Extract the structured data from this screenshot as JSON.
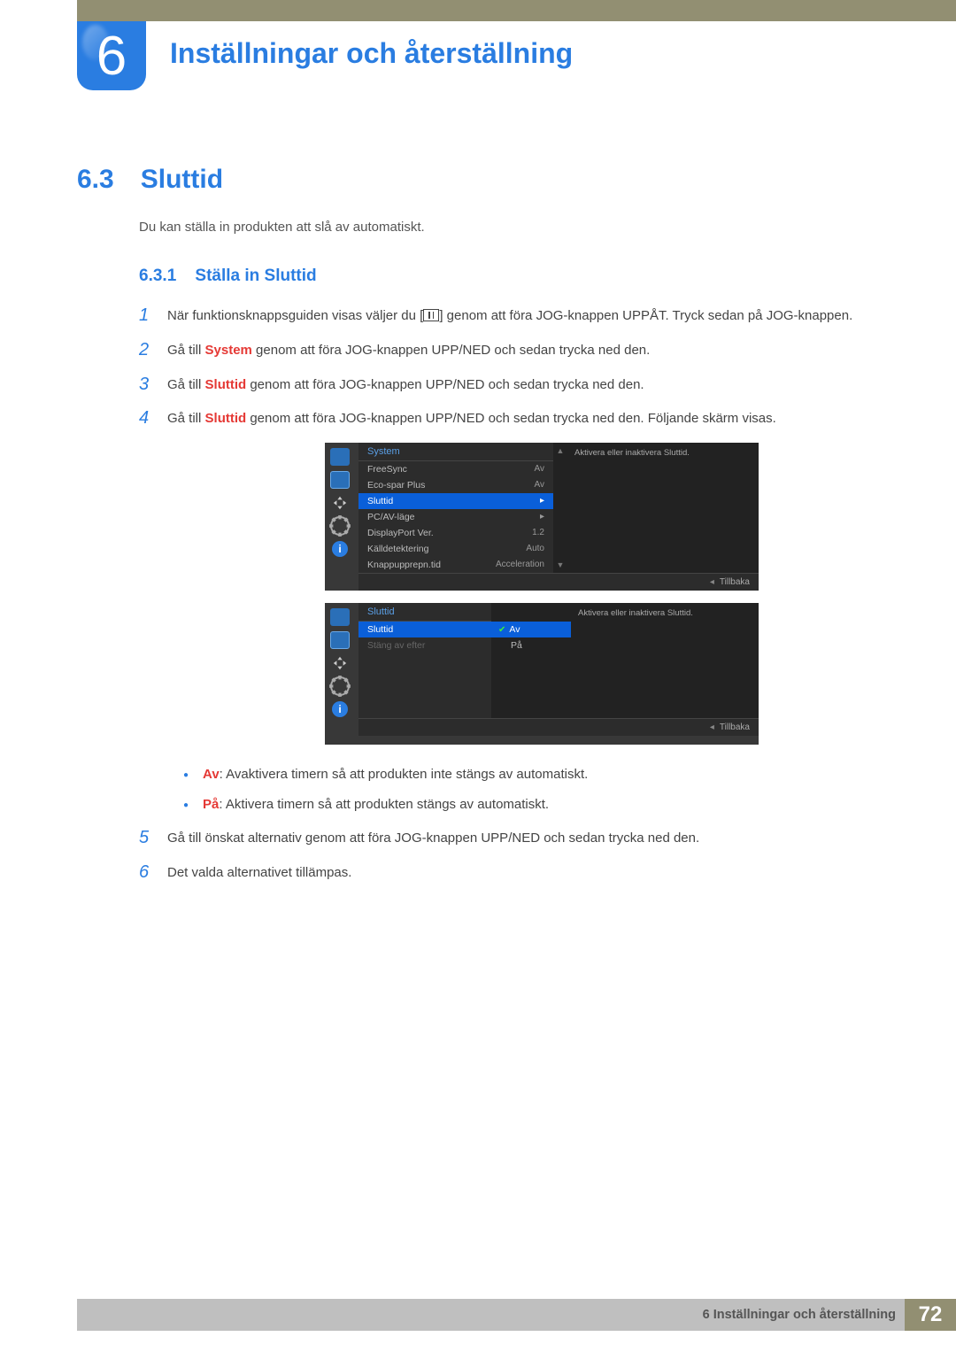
{
  "chapter": {
    "number": "6",
    "title": "Inställningar och återställning"
  },
  "section": {
    "number": "6.3",
    "title": "Sluttid"
  },
  "intro": "Du kan ställa in produkten att slå av automatiskt.",
  "subsection": {
    "number": "6.3.1",
    "title": "Ställa in Sluttid"
  },
  "steps": {
    "s1": {
      "num": "1",
      "pre": "När funktionsknappsguiden visas väljer du [",
      "post": "] genom att föra JOG-knappen UPPÅT. Tryck sedan på JOG-knappen."
    },
    "s2": {
      "num": "2",
      "pre": "Gå till ",
      "hl": "System",
      "post": " genom att föra JOG-knappen UPP/NED och sedan trycka ned den."
    },
    "s3": {
      "num": "3",
      "pre": "Gå till ",
      "hl": "Sluttid",
      "post": " genom att föra JOG-knappen UPP/NED och sedan trycka ned den."
    },
    "s4": {
      "num": "4",
      "pre": "Gå till ",
      "hl": "Sluttid",
      "post": " genom att föra JOG-knappen UPP/NED och sedan trycka ned den. Följande skärm visas."
    },
    "s5": {
      "num": "5",
      "text": "Gå till önskat alternativ genom att föra JOG-knappen UPP/NED och sedan trycka ned den."
    },
    "s6": {
      "num": "6",
      "text": "Det valda alternativet tillämpas."
    }
  },
  "osd1": {
    "header": "System",
    "help": "Aktivera eller inaktivera Sluttid.",
    "rows": [
      {
        "label": "FreeSync",
        "value": "Av"
      },
      {
        "label": "Eco-spar Plus",
        "value": "Av"
      },
      {
        "label": "Sluttid",
        "value": "▸",
        "selected": true
      },
      {
        "label": "PC/AV-läge",
        "value": "▸"
      },
      {
        "label": "DisplayPort Ver.",
        "value": "1.2"
      },
      {
        "label": "Källdetektering",
        "value": "Auto"
      },
      {
        "label": "Knappupprepn.tid",
        "value": "Acceleration"
      }
    ],
    "back": "Tillbaka"
  },
  "osd2": {
    "header": "Sluttid",
    "help": "Aktivera eller inaktivera Sluttid.",
    "rows": [
      {
        "label": "Sluttid",
        "selected": true
      },
      {
        "label": "Stäng av efter",
        "dim": true
      }
    ],
    "options": [
      {
        "label": "Av",
        "selected": true
      },
      {
        "label": "På"
      }
    ],
    "back": "Tillbaka"
  },
  "bullets": {
    "b1": {
      "hl": "Av",
      "text": ": Avaktivera timern så att produkten inte stängs av automatiskt."
    },
    "b2": {
      "hl": "På",
      "text": ": Aktivera timern så att produkten stängs av automatiskt."
    }
  },
  "footer": {
    "text": "6 Inställningar och återställning",
    "page": "72"
  }
}
